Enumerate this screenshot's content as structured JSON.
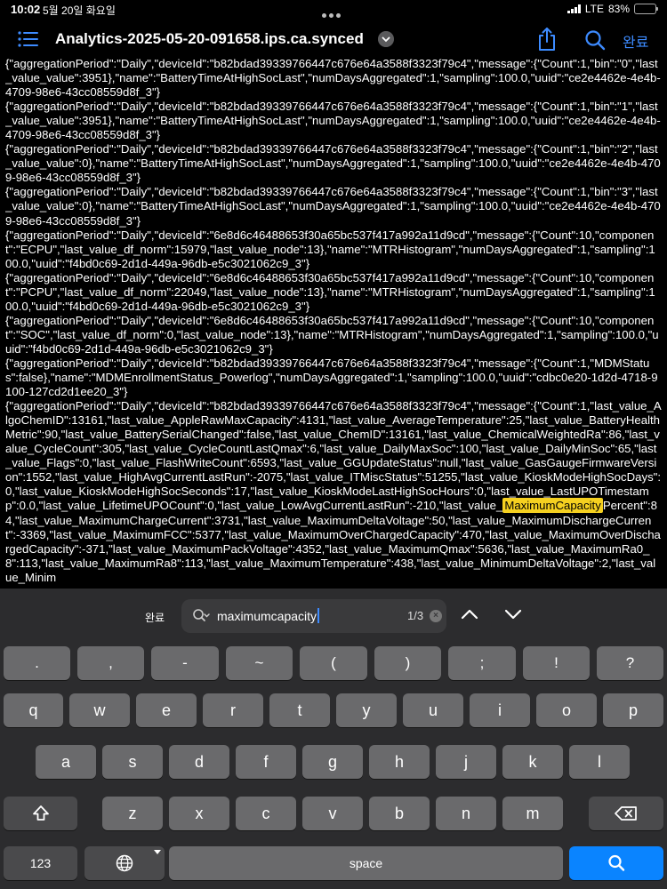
{
  "status": {
    "time": "10:02",
    "date": "5월 20일 화요일",
    "network": "LTE",
    "battery": "83%",
    "battery_level": 0.83
  },
  "nav": {
    "title": "Analytics-2025-05-20-091658.ips.ca.synced",
    "done": "완료",
    "icons": [
      "list-icon",
      "chevron-down-icon",
      "share-icon",
      "search-icon"
    ]
  },
  "log": {
    "text_before": "{\"aggregationPeriod\":\"Daily\",\"deviceId\":\"b82bdad39339766447c676e64a3588f3323f79c4\",\"message\":{\"Count\":1,\"bin\":\"0\",\"last_value_value\":3951},\"name\":\"BatteryTimeAtHighSocLast\",\"numDaysAggregated\":1,\"sampling\":100.0,\"uuid\":\"ce2e4462e-4e4b-4709-98e6-43cc08559d8f_3\"}\n{\"aggregationPeriod\":\"Daily\",\"deviceId\":\"b82bdad39339766447c676e64a3588f3323f79c4\",\"message\":{\"Count\":1,\"bin\":\"1\",\"last_value_value\":3951},\"name\":\"BatteryTimeAtHighSocLast\",\"numDaysAggregated\":1,\"sampling\":100.0,\"uuid\":\"ce2e4462e-4e4b-4709-98e6-43cc08559d8f_3\"}\n{\"aggregationPeriod\":\"Daily\",\"deviceId\":\"b82bdad39339766447c676e64a3588f3323f79c4\",\"message\":{\"Count\":1,\"bin\":\"2\",\"last_value_value\":0},\"name\":\"BatteryTimeAtHighSocLast\",\"numDaysAggregated\":1,\"sampling\":100.0,\"uuid\":\"ce2e4462e-4e4b-4709-98e6-43cc08559d8f_3\"}\n{\"aggregationPeriod\":\"Daily\",\"deviceId\":\"b82bdad39339766447c676e64a3588f3323f79c4\",\"message\":{\"Count\":1,\"bin\":\"3\",\"last_value_value\":0},\"name\":\"BatteryTimeAtHighSocLast\",\"numDaysAggregated\":1,\"sampling\":100.0,\"uuid\":\"ce2e4462e-4e4b-4709-98e6-43cc08559d8f_3\"}\n{\"aggregationPeriod\":\"Daily\",\"deviceId\":\"6e8d6c46488653f30a65bc537f417a992a11d9cd\",\"message\":{\"Count\":10,\"component\":\"ECPU\",\"last_value_df_norm\":15979,\"last_value_node\":13},\"name\":\"MTRHistogram\",\"numDaysAggregated\":1,\"sampling\":100.0,\"uuid\":\"f4bd0c69-2d1d-449a-96db-e5c3021062c9_3\"}\n{\"aggregationPeriod\":\"Daily\",\"deviceId\":\"6e8d6c46488653f30a65bc537f417a992a11d9cd\",\"message\":{\"Count\":10,\"component\":\"PCPU\",\"last_value_df_norm\":22049,\"last_value_node\":13},\"name\":\"MTRHistogram\",\"numDaysAggregated\":1,\"sampling\":100.0,\"uuid\":\"f4bd0c69-2d1d-449a-96db-e5c3021062c9_3\"}\n{\"aggregationPeriod\":\"Daily\",\"deviceId\":\"6e8d6c46488653f30a65bc537f417a992a11d9cd\",\"message\":{\"Count\":10,\"component\":\"SOC\",\"last_value_df_norm\":0,\"last_value_node\":13},\"name\":\"MTRHistogram\",\"numDaysAggregated\":1,\"sampling\":100.0,\"uuid\":\"f4bd0c69-2d1d-449a-96db-e5c3021062c9_3\"}\n{\"aggregationPeriod\":\"Daily\",\"deviceId\":\"b82bdad39339766447c676e64a3588f3323f79c4\",\"message\":{\"Count\":1,\"MDMStatus\":false},\"name\":\"MDMEnrollmentStatus_Powerlog\",\"numDaysAggregated\":1,\"sampling\":100.0,\"uuid\":\"cdbc0e20-1d2d-4718-9100-127cd2d1ee20_3\"}\n{\"aggregationPeriod\":\"Daily\",\"deviceId\":\"b82bdad39339766447c676e64a3588f3323f79c4\",\"message\":{\"Count\":1,\"last_value_AlgoChemID\":13161,\"last_value_AppleRawMaxCapacity\":4131,\"last_value_AverageTemperature\":25,\"last_value_BatteryHealthMetric\":90,\"last_value_BatterySerialChanged\":false,\"last_value_ChemID\":13161,\"last_value_ChemicalWeightedRa\":86,\"last_value_CycleCount\":305,\"last_value_CycleCountLastQmax\":6,\"last_value_DailyMaxSoc\":100,\"last_value_DailyMinSoc\":65,\"last_value_Flags\":0,\"last_value_FlashWriteCount\":6593,\"last_value_GGUpdateStatus\":null,\"last_value_GasGaugeFirmwareVersion\":1552,\"last_value_HighAvgCurrentLastRun\":-2075,\"last_value_ITMiscStatus\":51255,\"last_value_KioskModeHighSocDays\":0,\"last_value_KioskModeHighSocSeconds\":17,\"last_value_KioskModeLastHighSocHours\":0,\"last_value_LastUPOTimestamp\":0.0,\"last_value_LifetimeUPOCount\":0,\"last_value_LowAvgCurrentLastRun\":-210,\"last_value_",
    "highlight": "MaximumCapacity",
    "text_after": "Percent\":84,\"last_value_MaximumChargeCurrent\":3731,\"last_value_MaximumDeltaVoltage\":50,\"last_value_MaximumDischargeCurrent\":-3369,\"last_value_MaximumFCC\":5377,\"last_value_MaximumOverChargedCapacity\":470,\"last_value_MaximumOverDischargedCapacity\":-371,\"last_value_MaximumPackVoltage\":4352,\"last_value_MaximumQmax\":5636,\"last_value_MaximumRa0_8\":113,\"last_value_MaximumRa8\":113,\"last_value_MaximumTemperature\":438,\"last_value_MinimumDeltaVoltage\":2,\"last_value_Minim"
  },
  "find": {
    "done": "완료",
    "query": "maximumcapacity",
    "count": "1/3",
    "clear": "×"
  },
  "keyboard": {
    "row0": [
      ".",
      ",",
      "-",
      "~",
      "(",
      ")",
      ";",
      "!",
      "?"
    ],
    "row1": [
      "q",
      "w",
      "e",
      "r",
      "t",
      "y",
      "u",
      "i",
      "o",
      "p"
    ],
    "row2": [
      "a",
      "s",
      "d",
      "f",
      "g",
      "h",
      "j",
      "k",
      "l"
    ],
    "row3": [
      "z",
      "x",
      "c",
      "v",
      "b",
      "n",
      "m"
    ],
    "numbers_key": "123",
    "space_key": "space",
    "icons": [
      "shift-icon",
      "backspace-icon",
      "globe-icon",
      "search-icon"
    ]
  },
  "colors": {
    "accent": "#0a84ff",
    "highlight": "#f5d020",
    "keyboard_bg": "#2c2c2e",
    "key": "#6a6a6c",
    "key_dark": "#4a4a4c"
  }
}
